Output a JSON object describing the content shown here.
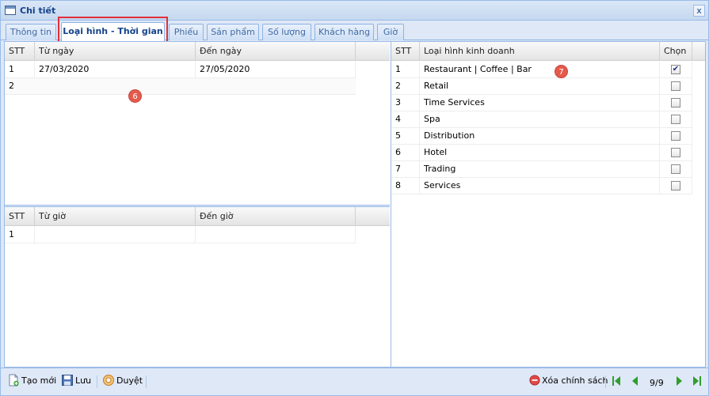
{
  "window": {
    "title": "Chi tiết",
    "close_label": "x"
  },
  "tabs": [
    {
      "label": "Thông tin"
    },
    {
      "label": "Loại hình - Thời gian",
      "active": true
    },
    {
      "label": "Phiếu"
    },
    {
      "label": "Sản phẩm"
    },
    {
      "label": "Số lượng"
    },
    {
      "label": "Khách hàng"
    },
    {
      "label": "Giờ"
    }
  ],
  "date_grid": {
    "headers": [
      "STT",
      "Từ ngày",
      "Đến ngày"
    ],
    "rows": [
      {
        "stt": "1",
        "from": "27/03/2020",
        "to": "27/05/2020"
      },
      {
        "stt": "2",
        "from": "",
        "to": ""
      }
    ]
  },
  "time_grid": {
    "headers": [
      "STT",
      "Từ giờ",
      "Đến giờ"
    ],
    "rows": [
      {
        "stt": "1",
        "from": "",
        "to": ""
      }
    ]
  },
  "business_grid": {
    "headers": [
      "STT",
      "Loại hình kinh doanh",
      "Chọn"
    ],
    "rows": [
      {
        "stt": "1",
        "name": "Restaurant | Coffee | Bar",
        "checked": true
      },
      {
        "stt": "2",
        "name": "Retail",
        "checked": false
      },
      {
        "stt": "3",
        "name": "Time Services",
        "checked": false
      },
      {
        "stt": "4",
        "name": "Spa",
        "checked": false
      },
      {
        "stt": "5",
        "name": "Distribution",
        "checked": false
      },
      {
        "stt": "6",
        "name": "Hotel",
        "checked": false
      },
      {
        "stt": "7",
        "name": "Trading",
        "checked": false
      },
      {
        "stt": "8",
        "name": "Services",
        "checked": false
      }
    ]
  },
  "annotations": {
    "badge_date": "6",
    "badge_business": "7"
  },
  "toolbar": {
    "new_label": "Tạo mới",
    "save_label": "Lưu",
    "approve_label": "Duyệt",
    "delete_label": "Xóa chính sách",
    "page_text": "9/9"
  },
  "colors": {
    "accent": "#15428b",
    "border": "#99bbe8",
    "highlight": "#e0303a",
    "badge": "#e55a4c",
    "nav_green": "#2e9e2e"
  }
}
